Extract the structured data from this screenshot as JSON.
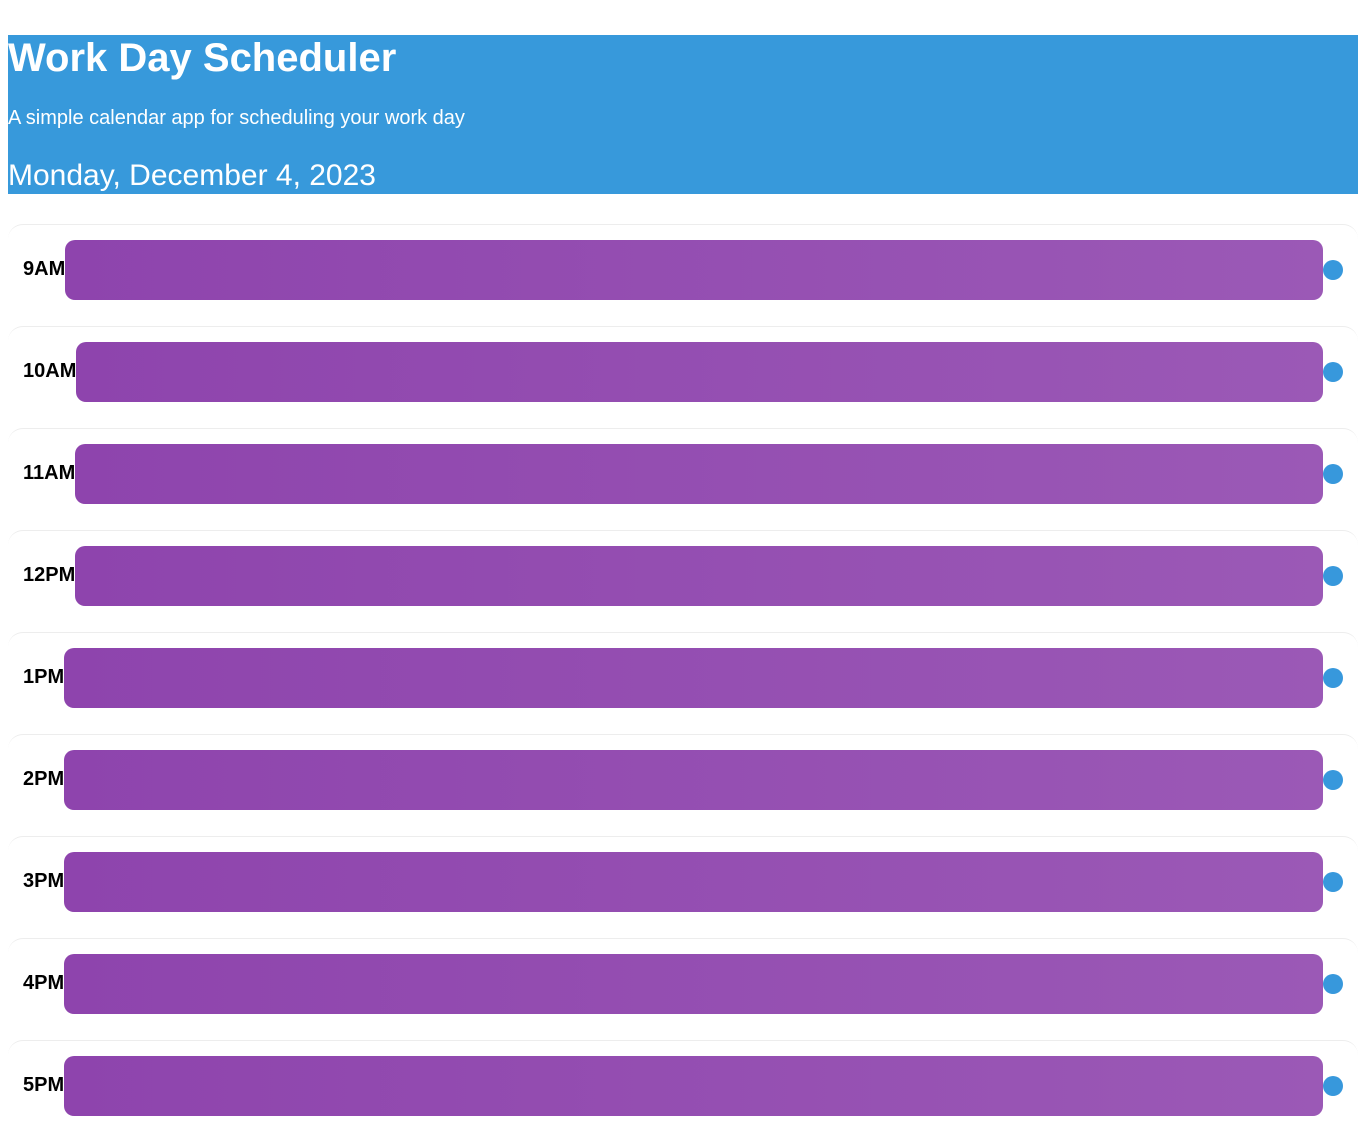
{
  "header": {
    "title": "Work Day Scheduler",
    "subtitle": "A simple calendar app for scheduling your work day",
    "current_date": "Monday, December 4, 2023"
  },
  "time_blocks": [
    {
      "hour": "9AM",
      "description": ""
    },
    {
      "hour": "10AM",
      "description": ""
    },
    {
      "hour": "11AM",
      "description": ""
    },
    {
      "hour": "12PM",
      "description": ""
    },
    {
      "hour": "1PM",
      "description": ""
    },
    {
      "hour": "2PM",
      "description": ""
    },
    {
      "hour": "3PM",
      "description": ""
    },
    {
      "hour": "4PM",
      "description": ""
    },
    {
      "hour": "5PM",
      "description": ""
    }
  ],
  "colors": {
    "header_background": "#3799db",
    "block_past": "#8e44ad",
    "save_button": "#3798dc"
  }
}
